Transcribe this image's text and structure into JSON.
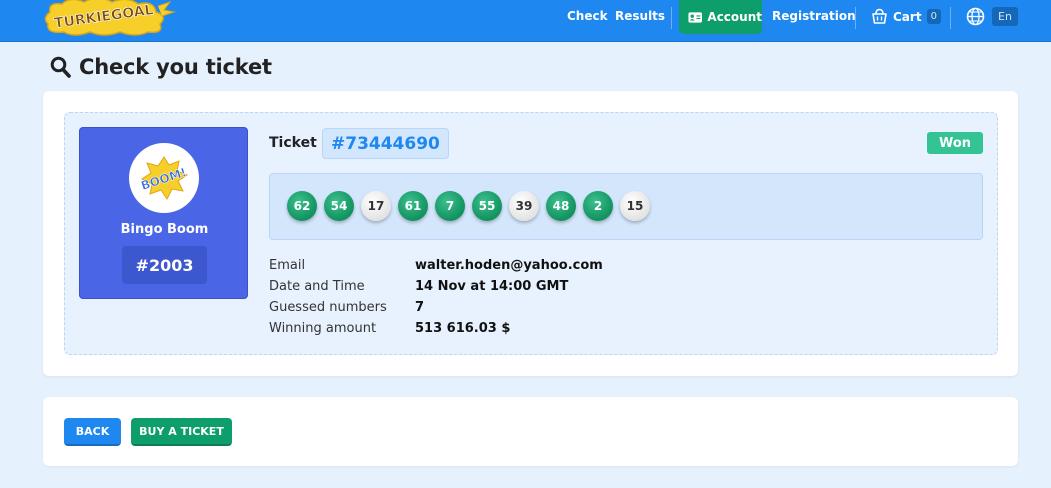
{
  "brand": {
    "logo_text": "TURKIEGOAL"
  },
  "nav": {
    "check": "Check",
    "results": "Results",
    "account": "Account",
    "registration": "Registration",
    "cart": "Cart",
    "cart_count": "0",
    "language": "En"
  },
  "page": {
    "title": "Check you ticket"
  },
  "game": {
    "logo_text": "BOOM!",
    "name": "Bingo Boom",
    "number": "#2003"
  },
  "ticket": {
    "label": "Ticket",
    "id": "#73444690",
    "status": "Won",
    "balls": [
      {
        "value": "62",
        "matched": true
      },
      {
        "value": "54",
        "matched": true
      },
      {
        "value": "17",
        "matched": false
      },
      {
        "value": "61",
        "matched": true
      },
      {
        "value": "7",
        "matched": true
      },
      {
        "value": "55",
        "matched": true
      },
      {
        "value": "39",
        "matched": false
      },
      {
        "value": "48",
        "matched": true
      },
      {
        "value": "2",
        "matched": true
      },
      {
        "value": "15",
        "matched": false
      }
    ],
    "details": [
      {
        "label": "Email",
        "value": "walter.hoden@yahoo.com"
      },
      {
        "label": "Date and Time",
        "value": "14 Nov at 14:00 GMT"
      },
      {
        "label": "Guessed numbers",
        "value": "7"
      },
      {
        "label": "Winning amount",
        "value": "513 616.03 $"
      }
    ]
  },
  "actions": {
    "back": "BACK",
    "buy": "BUY A TICKET"
  },
  "colors": {
    "header": "#1e88f0",
    "accent_green": "#0e9e6b",
    "won_badge": "#34c393",
    "game_tile": "#4a65e5"
  }
}
